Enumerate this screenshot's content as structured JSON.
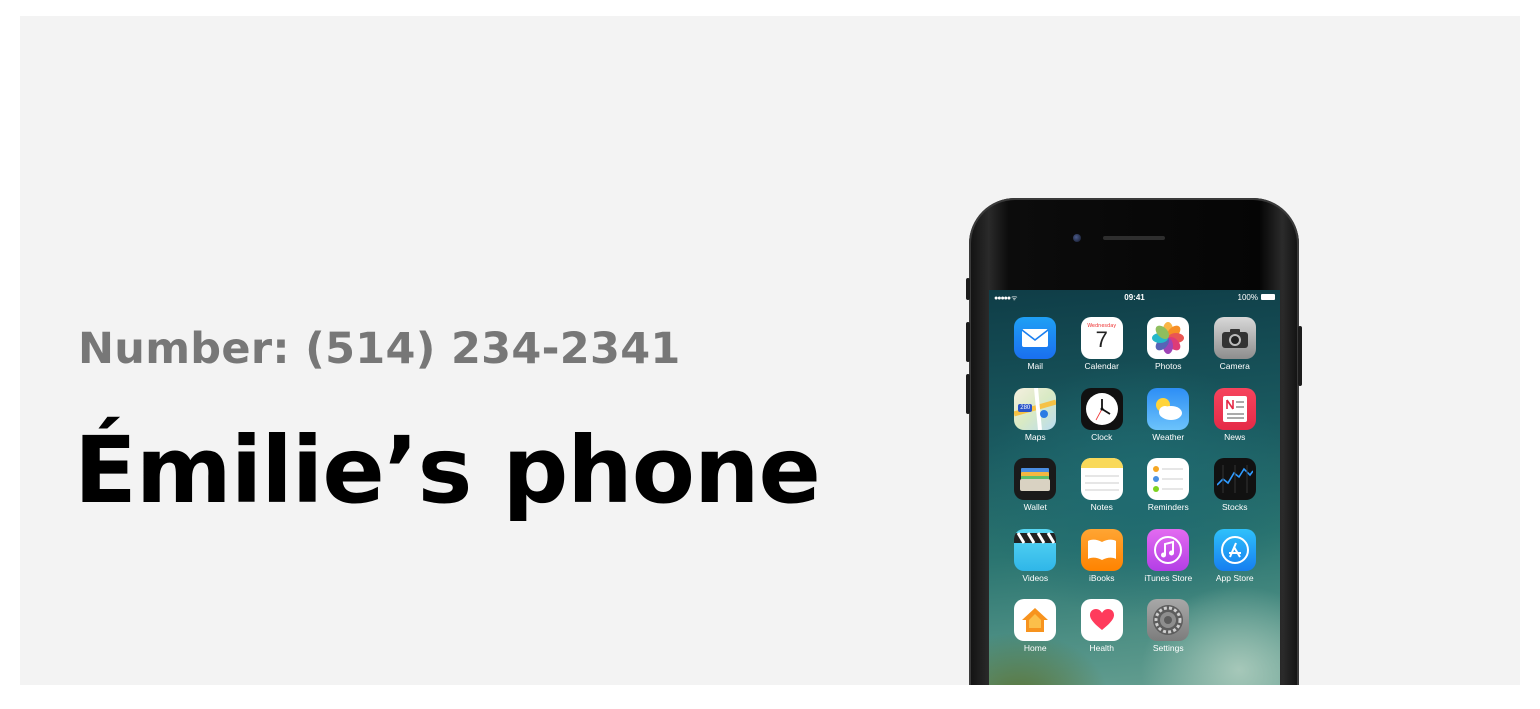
{
  "banner": {
    "number_text": "Number: (514) 234-2341",
    "title": "Émilie’s phone"
  },
  "phone": {
    "status_bar": {
      "signal": "●●●●● ᯤ",
      "time": "09:41",
      "battery": "100%"
    },
    "apps": [
      {
        "label": "Mail",
        "icon": "mail-icon"
      },
      {
        "label": "Calendar",
        "icon": "calendar-icon",
        "weekday": "Wednesday",
        "date": "7"
      },
      {
        "label": "Photos",
        "icon": "photos-icon"
      },
      {
        "label": "Camera",
        "icon": "camera-icon"
      },
      {
        "label": "Maps",
        "icon": "maps-icon",
        "badge": "280"
      },
      {
        "label": "Clock",
        "icon": "clock-icon"
      },
      {
        "label": "Weather",
        "icon": "weather-icon"
      },
      {
        "label": "News",
        "icon": "news-icon"
      },
      {
        "label": "Wallet",
        "icon": "wallet-icon"
      },
      {
        "label": "Notes",
        "icon": "notes-icon"
      },
      {
        "label": "Reminders",
        "icon": "reminders-icon"
      },
      {
        "label": "Stocks",
        "icon": "stocks-icon"
      },
      {
        "label": "Videos",
        "icon": "videos-icon"
      },
      {
        "label": "iBooks",
        "icon": "ibooks-icon"
      },
      {
        "label": "iTunes Store",
        "icon": "itunes-store-icon"
      },
      {
        "label": "App Store",
        "icon": "app-store-icon"
      },
      {
        "label": "Home",
        "icon": "home-icon"
      },
      {
        "label": "Health",
        "icon": "health-icon"
      },
      {
        "label": "Settings",
        "icon": "settings-icon"
      }
    ]
  },
  "colors": {
    "banner_background": "#f3f3f3",
    "number_text": "#777777",
    "title_text": "#000000"
  }
}
